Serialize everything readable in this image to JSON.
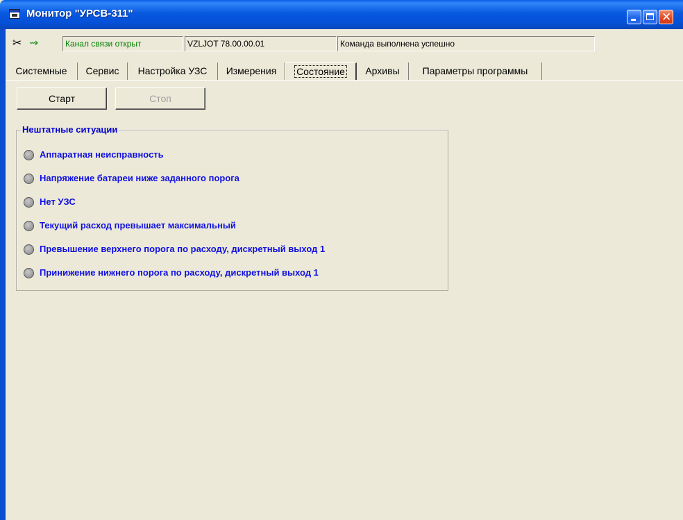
{
  "window": {
    "title": "Монитор \"УРСВ-311\"",
    "controls": {
      "minimize": "minimize-icon",
      "maximize": "maximize-icon",
      "close": "close-icon"
    }
  },
  "status": {
    "channel": "Канал связи открыт",
    "version": "VZLJOT 78.00.00.01",
    "message": "Команда выполнена успешно",
    "icons": [
      "disconnect-icon",
      "plug-icon"
    ],
    "channel_color": "#008000"
  },
  "tabs": [
    {
      "label": "Системные"
    },
    {
      "label": "Сервис"
    },
    {
      "label": "Настройка УЗС"
    },
    {
      "label": "Измерения"
    },
    {
      "label": "Состояние",
      "active": true
    },
    {
      "label": "Архивы"
    },
    {
      "label": "Параметры программы"
    }
  ],
  "buttons": {
    "start": "Старт",
    "stop": "Стоп",
    "stop_enabled": false
  },
  "alarms": {
    "title": "Нештатные ситуации",
    "label_color": "#1010e0",
    "items": [
      {
        "label": "Аппаратная неисправность",
        "state": "off"
      },
      {
        "label": "Напряжение батареи ниже заданного порога",
        "state": "off"
      },
      {
        "label": "Нет УЗС",
        "state": "off"
      },
      {
        "label": "Текущий расход превышает максимальный",
        "state": "off"
      },
      {
        "label": "Превышение верхнего порога по расходу, дискретный выход 1",
        "state": "off"
      },
      {
        "label": "Принижение нижнего порога по расходу, дискретный выход 1",
        "state": "off"
      }
    ]
  }
}
